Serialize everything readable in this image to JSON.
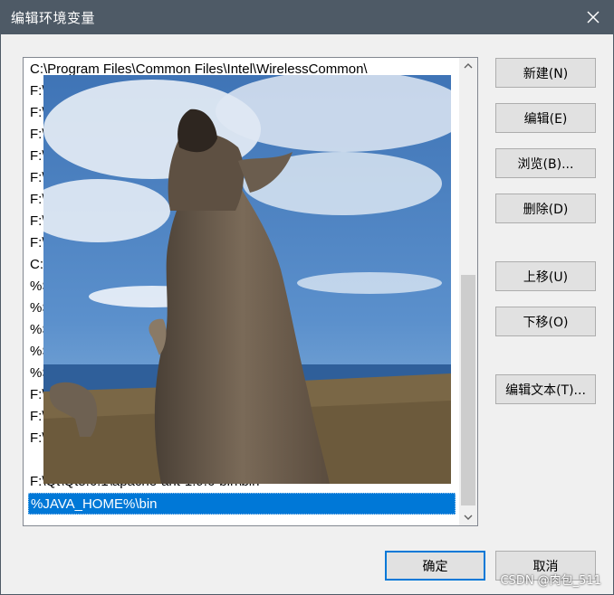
{
  "window": {
    "title": "编辑环境变量"
  },
  "list": {
    "items": [
      "C:\\Program Files\\Common Files\\Intel\\WirelessCommon\\",
      "F:\\",
      "F:\\",
      "F:\\",
      "F:\\",
      "F:\\",
      "F:\\",
      "F:\\",
      "F:\\",
      "C:\\",
      "%S",
      "%S",
      "%S",
      "%S",
      "%S",
      "F:\\",
      "F:\\",
      "F:\\",
      "F:\\Qt\\Qt5.6.1\\apache-ant-1.9.6-bin\\bin",
      "%JAVA_HOME%\\bin"
    ],
    "selected_index": 19
  },
  "buttons": {
    "new": "新建(N)",
    "edit": "编辑(E)",
    "browse": "浏览(B)...",
    "delete": "删除(D)",
    "move_up": "上移(U)",
    "move_down": "下移(O)",
    "edit_text": "编辑文本(T)...",
    "ok": "确定",
    "cancel": "取消"
  },
  "overlay": {
    "icon": "kangaroo-photo"
  },
  "watermark": "CSDN @肉包_511",
  "colors": {
    "titlebar": "#4e5a66",
    "selection": "#0078d7",
    "primary_border": "#0078d7"
  }
}
